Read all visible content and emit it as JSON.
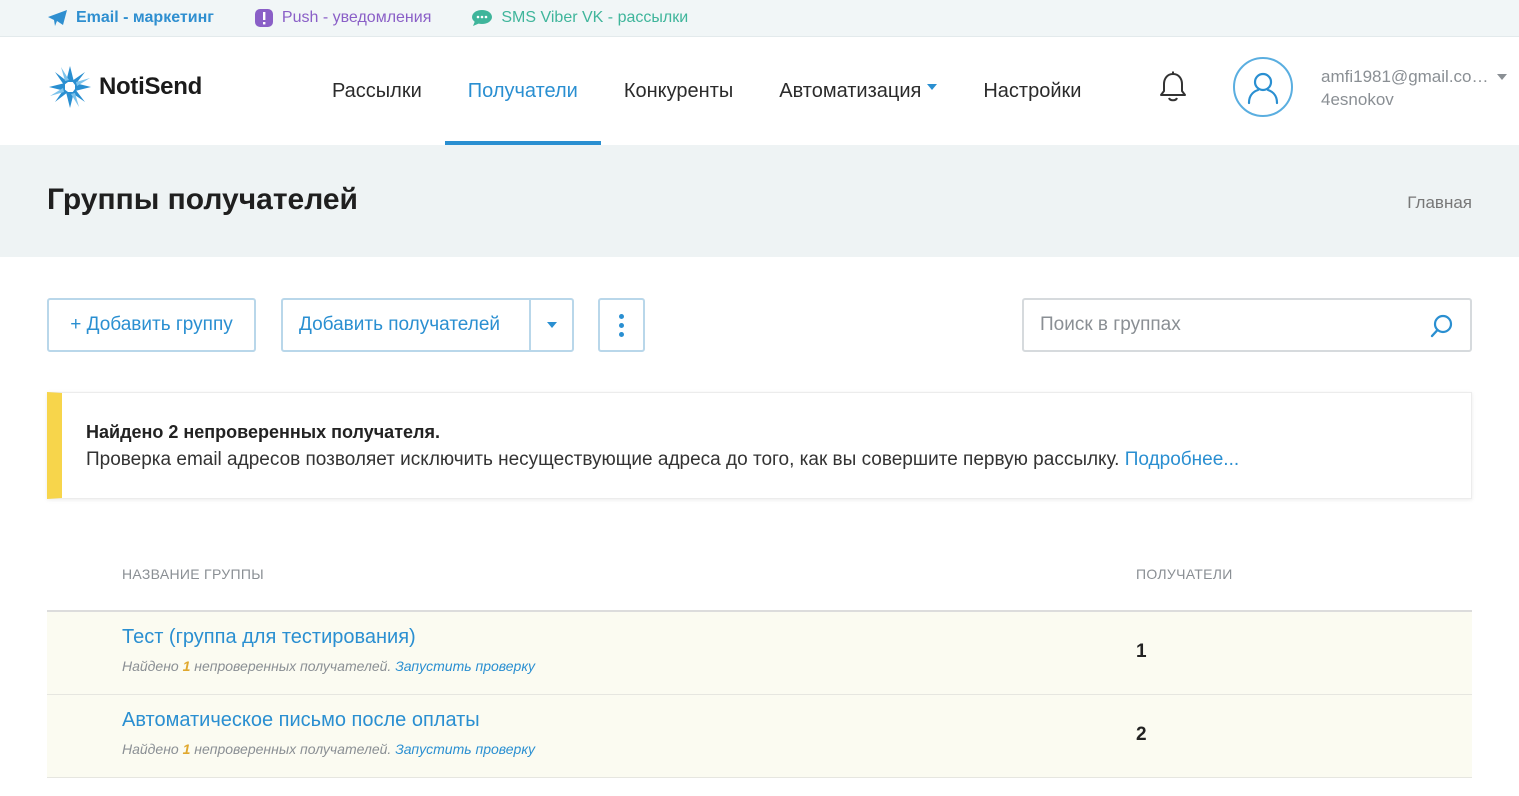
{
  "topbar": {
    "items": [
      {
        "label": "Email - маркетинг",
        "icon": "paper-plane-icon"
      },
      {
        "label": "Push - уведомления",
        "icon": "push-icon"
      },
      {
        "label": "SMS Viber VK - рассылки",
        "icon": "chat-bubble-icon"
      }
    ]
  },
  "header": {
    "logo_text": "NotiSend",
    "nav": [
      {
        "label": "Рассылки",
        "active": false
      },
      {
        "label": "Получатели",
        "active": true
      },
      {
        "label": "Конкуренты",
        "active": false
      },
      {
        "label": "Автоматизация",
        "active": false,
        "has_dropdown": true
      },
      {
        "label": "Настройки",
        "active": false
      }
    ],
    "user_email": "amfi1981@gmail.co…",
    "user_login": "4esnokov"
  },
  "page": {
    "title": "Группы получателей",
    "breadcrumb": "Главная"
  },
  "toolbar": {
    "add_group_label": "+ Добавить группу",
    "add_recipients_label": "Добавить получателей",
    "search_placeholder": "Поиск в группах"
  },
  "alert": {
    "title": "Найдено 2 непроверенных получателя.",
    "text": "Проверка email адресов позволяет исключить несуществующие адреса до того, как вы совершите первую рассылку.",
    "link": "Подробнее..."
  },
  "table": {
    "columns": [
      "НАЗВАНИЕ ГРУППЫ",
      "ПОЛУЧАТЕЛИ"
    ],
    "rows": [
      {
        "name": "Тест (группа для тестирования)",
        "sub_prefix": "Найдено",
        "sub_count": "1",
        "sub_suffix": "непроверенных получателей.",
        "sub_link": "Запустить проверку",
        "recipients": "1"
      },
      {
        "name": "Автоматическое письмо после оплаты",
        "sub_prefix": "Найдено",
        "sub_count": "1",
        "sub_suffix": "непроверенных получателей.",
        "sub_link": "Запустить проверку",
        "recipients": "2"
      }
    ]
  },
  "colors": {
    "accent": "#2a8fd1",
    "alert_stripe": "#f7d54b",
    "row_bg": "#fbfbf1",
    "push": "#8a5fc7",
    "sms": "#3fb59b"
  }
}
